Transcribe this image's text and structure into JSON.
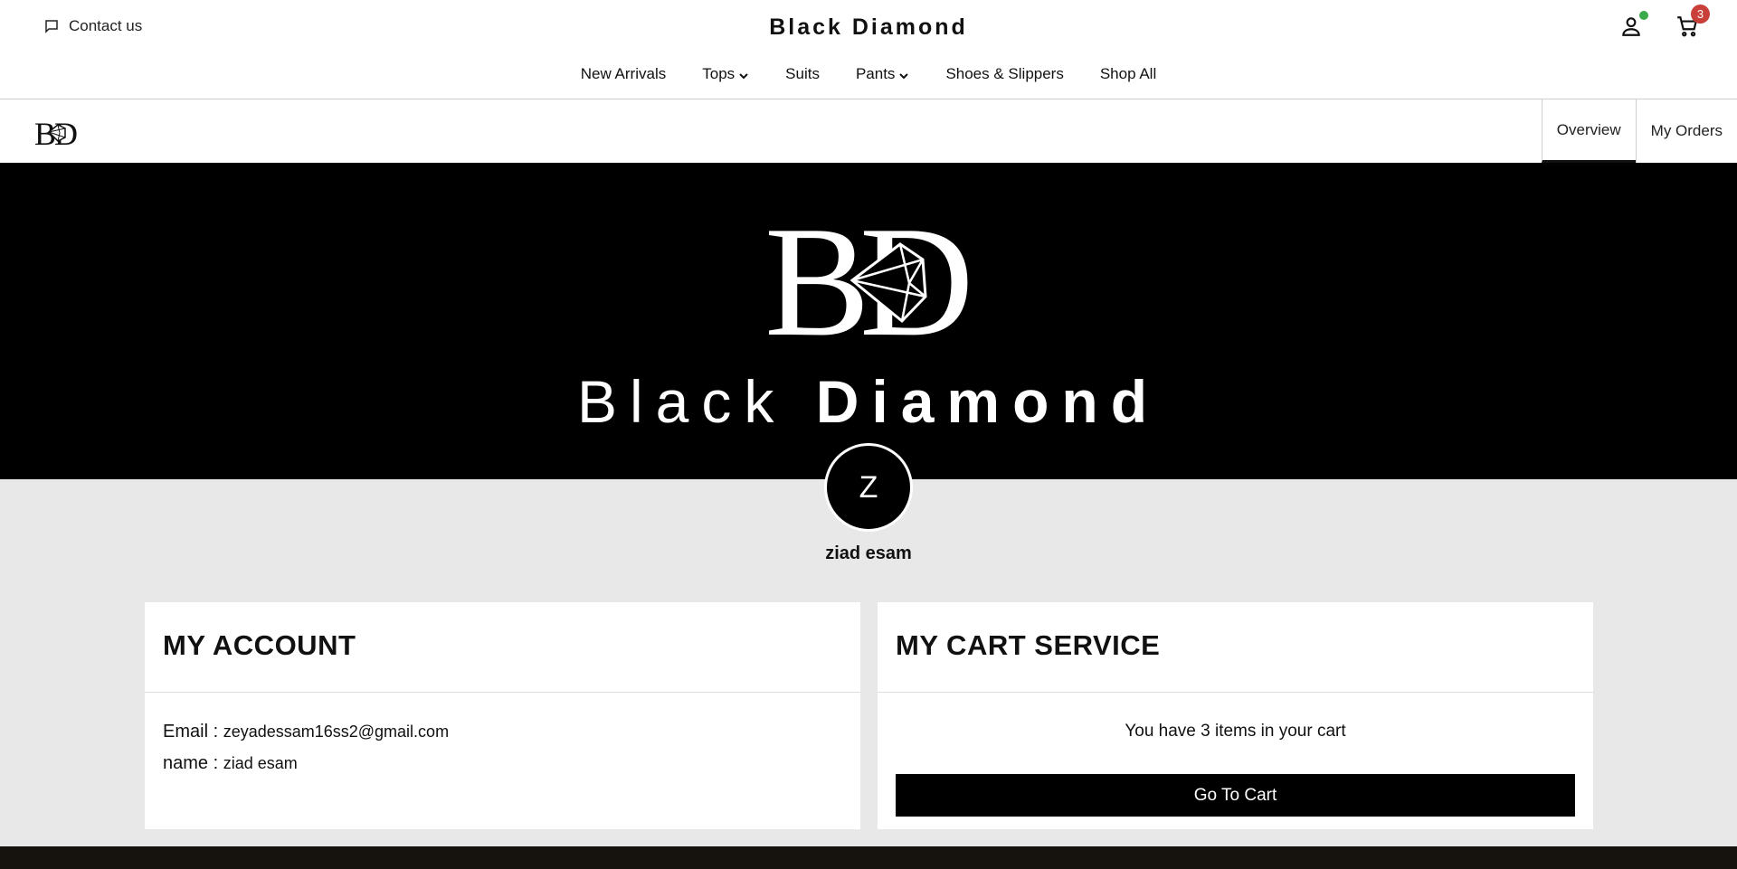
{
  "header": {
    "contact_label": "Contact us",
    "brand_title": "Black Diamond",
    "cart_count": "3",
    "icons": [
      "chat-icon",
      "user-icon",
      "cart-icon",
      "chevron-down-icon"
    ],
    "online_status_color": "#3aaa4a",
    "badge_color": "#c9403a"
  },
  "nav": {
    "items": [
      {
        "label": "New Arrivals",
        "has_dropdown": false
      },
      {
        "label": "Tops",
        "has_dropdown": true
      },
      {
        "label": "Suits",
        "has_dropdown": false
      },
      {
        "label": "Pants",
        "has_dropdown": true
      },
      {
        "label": "Shoes & Slippers",
        "has_dropdown": false
      },
      {
        "label": "Shop All",
        "has_dropdown": false
      }
    ]
  },
  "account_bar": {
    "tabs": [
      {
        "label": "Overview",
        "active": true
      },
      {
        "label": "My Orders",
        "active": false
      }
    ]
  },
  "hero": {
    "wordmark_light": "Black",
    "wordmark_bold": "Diamond",
    "background": "#000000"
  },
  "profile": {
    "initial": "Z",
    "name": "ziad esam"
  },
  "account_card": {
    "title": "MY ACCOUNT",
    "email_label": "Email :",
    "email_value": "zeyadessam16ss2@gmail.com",
    "name_label": "name :",
    "name_value": "ziad esam"
  },
  "cart_card": {
    "title": "MY CART SERVICE",
    "message": "You have 3 items in your cart",
    "button_label": "Go To Cart"
  }
}
